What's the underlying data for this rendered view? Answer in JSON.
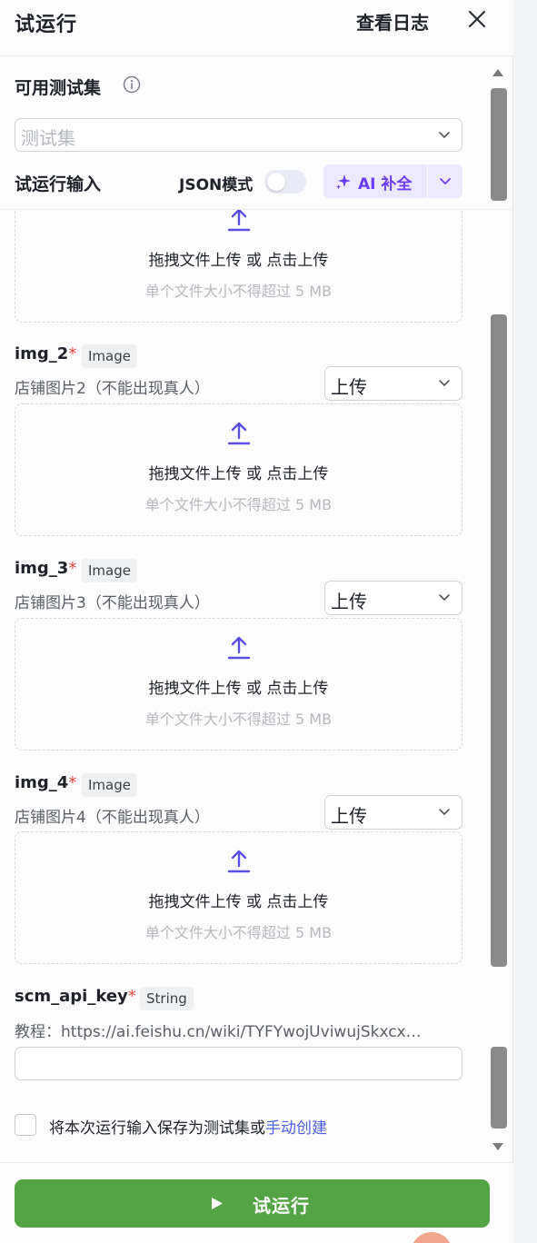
{
  "header": {
    "title": "试运行",
    "view_log": "查看日志"
  },
  "testset": {
    "label": "可用测试集",
    "placeholder": "测试集"
  },
  "run_input": {
    "label": "试运行输入",
    "json_mode_label": "JSON模式",
    "json_mode_on": false,
    "ai_button": "AI 补全"
  },
  "upload": {
    "main_text": "拖拽文件上传 或 点击上传",
    "hint": "单个文件大小不得超过 5 MB"
  },
  "fields": [
    {
      "name": "img_2",
      "required_mark": "*",
      "type": "Image",
      "desc": "店铺图片2（不能出现真人）",
      "mode": "上传"
    },
    {
      "name": "img_3",
      "required_mark": "*",
      "type": "Image",
      "desc": "店铺图片3（不能出现真人）",
      "mode": "上传"
    },
    {
      "name": "img_4",
      "required_mark": "*",
      "type": "Image",
      "desc": "店铺图片4（不能出现真人）",
      "mode": "上传"
    },
    {
      "name": "scm_api_key",
      "required_mark": "*",
      "type": "String",
      "desc": "教程：https://ai.feishu.cn/wiki/TYFYwojUviwujSkxcx…",
      "value": ""
    }
  ],
  "save_option": {
    "text": "将本次运行输入保存为测试集或",
    "link": "手动创建",
    "checked": false
  },
  "footer": {
    "run_button": "试运行"
  },
  "colors": {
    "accent_purple": "#6b3df0",
    "upload_icon": "#5b4ee6",
    "run_green": "#54a445",
    "required_red": "#e0463e",
    "link_blue": "#4c5fe6"
  }
}
